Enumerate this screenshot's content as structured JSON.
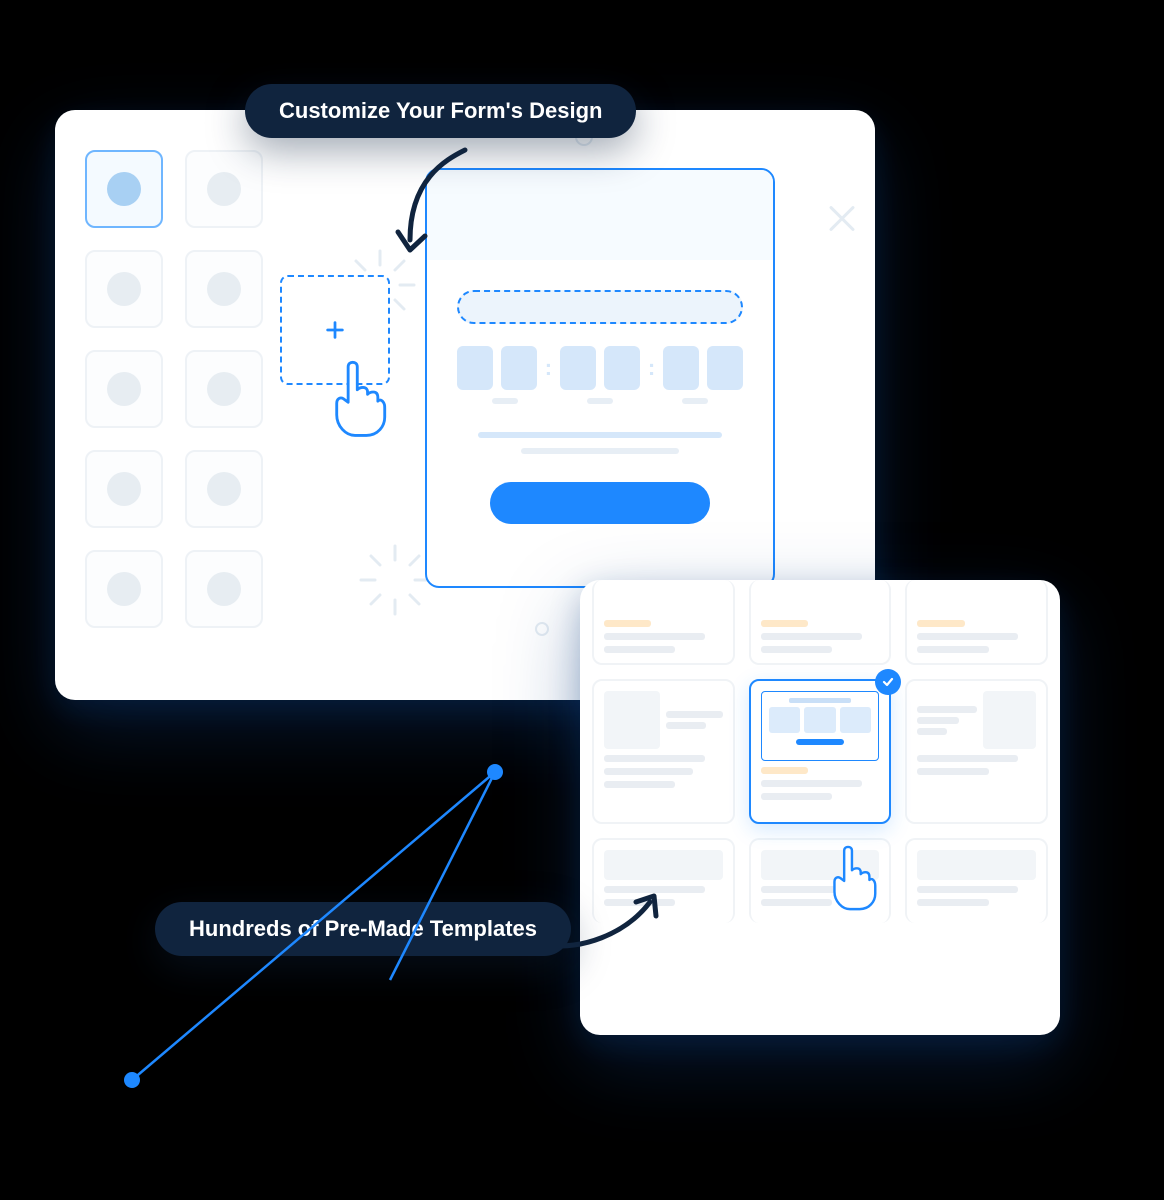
{
  "labels": {
    "customize": "Customize Your Form's Design",
    "templates": "Hundreds of Pre-Made Templates"
  },
  "icons": {
    "plus": "plus-icon",
    "pointer": "pointer-icon",
    "check": "check-icon",
    "arrow_down": "arrow-down-icon",
    "arrow_right": "arrow-right-icon"
  },
  "colors": {
    "accent": "#1e88ff",
    "dark_pill": "#10243e",
    "mute": "#e7edf2"
  },
  "editor": {
    "palette_items": 10,
    "selected_palette_index": 0,
    "timer_segments": 6
  },
  "templates": {
    "rows": 3,
    "cols": 3,
    "selected_index": 4
  }
}
